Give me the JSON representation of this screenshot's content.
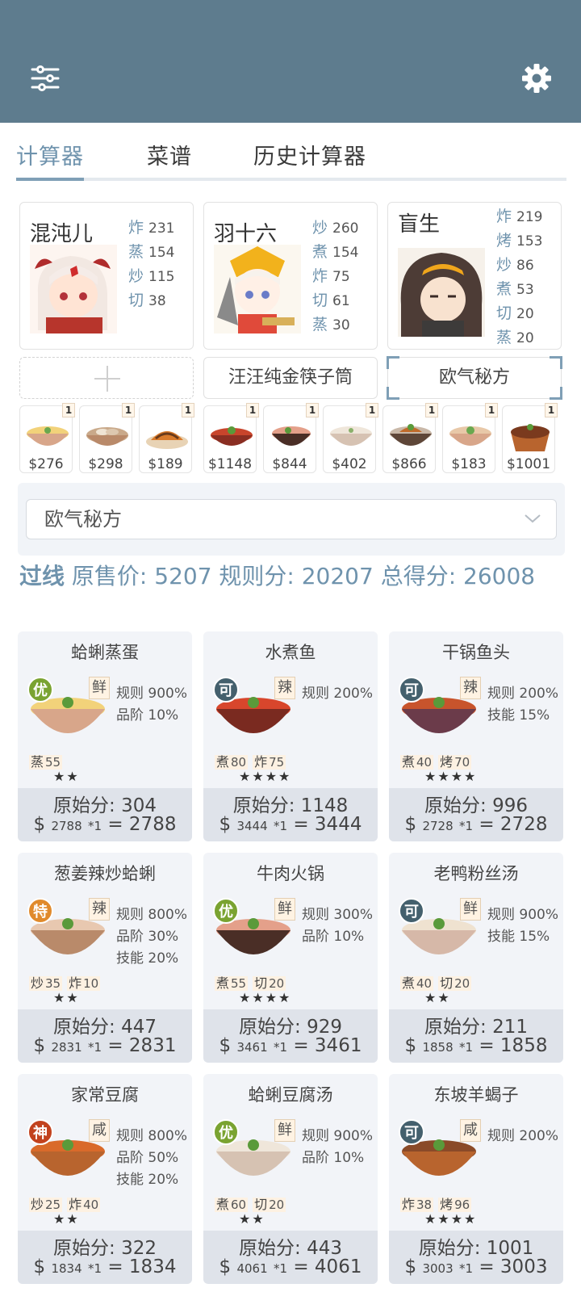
{
  "tabs": [
    "计算器",
    "菜谱",
    "历史计算器"
  ],
  "chefs": [
    {
      "name": "混沌儿",
      "stats": [
        {
          "k": "炸",
          "v": "231"
        },
        {
          "k": "蒸",
          "v": "154"
        },
        {
          "k": "炒",
          "v": "115"
        },
        {
          "k": "切",
          "v": "38"
        }
      ]
    },
    {
      "name": "羽十六",
      "stats": [
        {
          "k": "炒",
          "v": "260"
        },
        {
          "k": "煮",
          "v": "154"
        },
        {
          "k": "炸",
          "v": "75"
        },
        {
          "k": "切",
          "v": "61"
        },
        {
          "k": "蒸",
          "v": "30"
        }
      ]
    },
    {
      "name": "盲生",
      "stats": [
        {
          "k": "炸",
          "v": "219"
        },
        {
          "k": "烤",
          "v": "153"
        },
        {
          "k": "炒",
          "v": "86"
        },
        {
          "k": "煮",
          "v": "53"
        },
        {
          "k": "切",
          "v": "20"
        },
        {
          "k": "蒸",
          "v": "20"
        }
      ]
    }
  ],
  "equip": {
    "slot2": "汪汪纯金筷子筒",
    "slot3": "欧气秘方"
  },
  "materials": [
    {
      "count": "1",
      "price": "$276"
    },
    {
      "count": "1",
      "price": "$298"
    },
    {
      "count": "1",
      "price": "$189"
    },
    {
      "count": "1",
      "price": "$1148"
    },
    {
      "count": "1",
      "price": "$844"
    },
    {
      "count": "1",
      "price": "$402"
    },
    {
      "count": "1",
      "price": "$866"
    },
    {
      "count": "1",
      "price": "$183"
    },
    {
      "count": "1",
      "price": "$1001"
    }
  ],
  "select_value": "欧气秘方",
  "summary": {
    "pass": "过线",
    "text": " 原售价:  5207 规则分:  20207 总得分:  26008"
  },
  "dishes": [
    {
      "name": "蛤蜊蒸蛋",
      "grade": "优",
      "flavor": "鲜",
      "bonus": [
        "规则 900%",
        "品阶 10%"
      ],
      "skills": [
        {
          "k": "蒸",
          "v": "55"
        }
      ],
      "stars": "★★",
      "orig": "原始分: 304",
      "base": "2788",
      "mult": "*1",
      "total": "2788"
    },
    {
      "name": "水煮鱼",
      "grade": "可",
      "flavor": "辣",
      "bonus": [
        "规则 200%"
      ],
      "skills": [
        {
          "k": "煮",
          "v": "80"
        },
        {
          "k": "炸",
          "v": "75"
        }
      ],
      "stars": "★★★★",
      "orig": "原始分: 1148",
      "base": "3444",
      "mult": "*1",
      "total": "3444"
    },
    {
      "name": "干锅鱼头",
      "grade": "可",
      "flavor": "辣",
      "bonus": [
        "规则 200%",
        "技能 15%"
      ],
      "skills": [
        {
          "k": "煮",
          "v": "40"
        },
        {
          "k": "烤",
          "v": "70"
        }
      ],
      "stars": "★★★★",
      "orig": "原始分: 996",
      "base": "2728",
      "mult": "*1",
      "total": "2728"
    },
    {
      "name": "葱姜辣炒蛤蜊",
      "grade": "特",
      "flavor": "辣",
      "bonus": [
        "规则 800%",
        "品阶 30%",
        "技能 20%"
      ],
      "skills": [
        {
          "k": "炒",
          "v": "35"
        },
        {
          "k": "炸",
          "v": "10"
        }
      ],
      "stars": "★★",
      "orig": "原始分: 447",
      "base": "2831",
      "mult": "*1",
      "total": "2831"
    },
    {
      "name": "牛肉火锅",
      "grade": "优",
      "flavor": "鲜",
      "bonus": [
        "规则 300%",
        "品阶 10%"
      ],
      "skills": [
        {
          "k": "煮",
          "v": "55"
        },
        {
          "k": "切",
          "v": "20"
        }
      ],
      "stars": "★★★★",
      "orig": "原始分: 929",
      "base": "3461",
      "mult": "*1",
      "total": "3461"
    },
    {
      "name": "老鸭粉丝汤",
      "grade": "可",
      "flavor": "鲜",
      "bonus": [
        "规则 900%",
        "技能 15%"
      ],
      "skills": [
        {
          "k": "煮",
          "v": "40"
        },
        {
          "k": "切",
          "v": "20"
        }
      ],
      "stars": "★★",
      "orig": "原始分: 211",
      "base": "1858",
      "mult": "*1",
      "total": "1858"
    },
    {
      "name": "家常豆腐",
      "grade": "神",
      "flavor": "咸",
      "bonus": [
        "规则 800%",
        "品阶 50%",
        "技能 20%"
      ],
      "skills": [
        {
          "k": "炒",
          "v": "25"
        },
        {
          "k": "炸",
          "v": "40"
        }
      ],
      "stars": "★★",
      "orig": "原始分: 322",
      "base": "1834",
      "mult": "*1",
      "total": "1834"
    },
    {
      "name": "蛤蜊豆腐汤",
      "grade": "优",
      "flavor": "鲜",
      "bonus": [
        "规则 900%",
        "品阶 10%"
      ],
      "skills": [
        {
          "k": "煮",
          "v": "60"
        },
        {
          "k": "切",
          "v": "20"
        }
      ],
      "stars": "★★",
      "orig": "原始分: 443",
      "base": "4061",
      "mult": "*1",
      "total": "4061"
    },
    {
      "name": "东坡羊蝎子",
      "grade": "可",
      "flavor": "咸",
      "bonus": [
        "规则 200%"
      ],
      "skills": [
        {
          "k": "炸",
          "v": "38"
        },
        {
          "k": "烤",
          "v": "96"
        }
      ],
      "stars": "★★★★",
      "orig": "原始分: 1001",
      "base": "3003",
      "mult": "*1",
      "total": "3003"
    }
  ],
  "colors": {
    "header": "#5e7c8e",
    "accent": "#6f93ad",
    "grade_you": "#7aa331",
    "grade_ke": "#44606d",
    "grade_te": "#e08a2c",
    "grade_shen": "#c2421e"
  }
}
